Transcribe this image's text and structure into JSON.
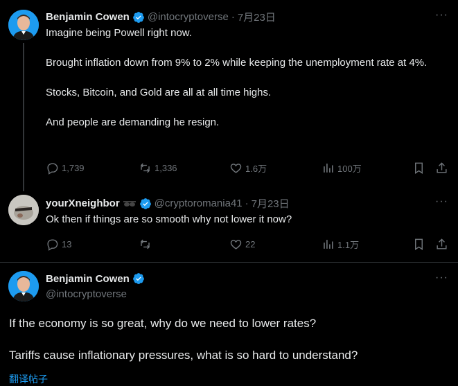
{
  "colors": {
    "background": "#000000",
    "text": "#e7e9ea",
    "muted": "#71767b",
    "accent": "#1d9bf0",
    "verified": "#1d9bf0"
  },
  "tweet1": {
    "name": "Benjamin Cowen",
    "handle": "@intocryptoverse",
    "separator": "·",
    "date": "7月23日",
    "more": "···",
    "paragraphs": [
      "Imagine being Powell right now.",
      "Brought inflation down from 9% to 2% while keeping the unemployment rate at 4%.",
      "Stocks, Bitcoin, and Gold are all at all time highs.",
      "And people are demanding he resign."
    ],
    "replies": "1,739",
    "retweets": "1,336",
    "likes": "1.6万",
    "views": "100万"
  },
  "tweet2": {
    "name": "yourXneighbor",
    "name_emoji": "🕶",
    "handle": "@cryptoromania41",
    "separator": "·",
    "date": "7月23日",
    "more": "···",
    "text": "Ok then if things are so smooth why not lower it now?",
    "replies": "13",
    "retweets": "",
    "likes": "22",
    "views": "1.1万"
  },
  "tweet3": {
    "name": "Benjamin Cowen",
    "handle": "@intocryptoverse",
    "more": "···",
    "paragraphs": [
      "If the economy is so great, why do we need to lower rates?",
      "Tariffs cause inflationary pressures, what is so hard to understand?"
    ],
    "translate": "翻译帖子"
  }
}
